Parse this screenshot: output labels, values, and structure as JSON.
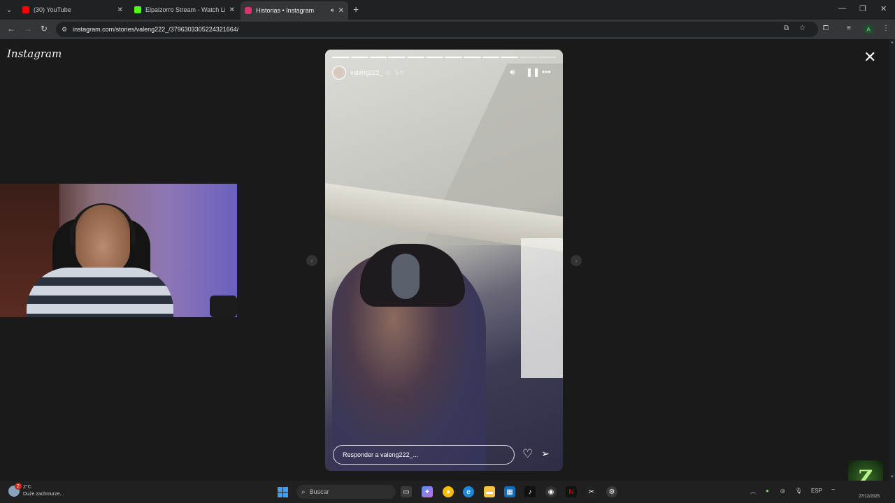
{
  "browser": {
    "tabs": [
      {
        "title": "(30) YouTube",
        "favicon_color": "#ff0000",
        "active": false
      },
      {
        "title": "Elpaizorro Stream - Watch Live",
        "favicon_color": "#53fc18",
        "active": false
      },
      {
        "title": "Historias • Instagram",
        "favicon_color": "#e1306c",
        "active": true
      }
    ],
    "url": "instagram.com/stories/valeng222_/3796303305224321664/"
  },
  "page": {
    "logo": "Instagram",
    "story": {
      "username": "valeng222_",
      "time": "5 h",
      "segments_total": 12,
      "segments_done": 10,
      "reply_placeholder": "Responder a valeng222_..."
    },
    "stream_logo": "Z"
  },
  "taskbar": {
    "weather_temp": "2°C",
    "weather_desc": "Duże zachmurze...",
    "notification_count": "2",
    "search_placeholder": "Buscar",
    "language": "ESP",
    "date": "27/12/2025"
  },
  "colors": {
    "accent_chrome": "#35363a",
    "ig_bg": "#1a1a1a"
  }
}
